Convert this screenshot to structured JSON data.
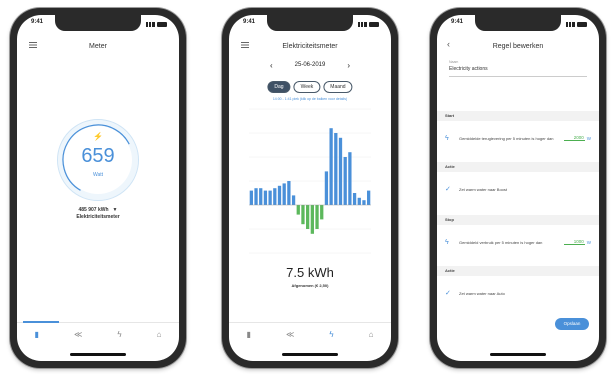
{
  "status": {
    "time": "9:41"
  },
  "phone1": {
    "title": "Meter",
    "gauge": {
      "value": "659",
      "unit": "Watt"
    },
    "meter": {
      "line1": "485 907 kWh",
      "line2": "Elektriciteitsmeter"
    },
    "tabs": [
      "bulb-icon",
      "chart-icon",
      "flash-icon",
      "settings-icon"
    ]
  },
  "phone2": {
    "title": "Elektriciteitsmeter",
    "date": "25-06-2019",
    "segments": [
      "Dag",
      "Week",
      "Maand"
    ],
    "note": "14:00 - 1:41 piek (klik op de balken voor details)",
    "kwh": "7.5  kWh",
    "kwh_sub": "Afgenomen (€ 2,50)",
    "chart_data": {
      "type": "bar",
      "values": [
        6,
        7,
        7,
        6,
        6,
        7,
        8,
        9,
        10,
        4,
        -4,
        -8,
        -10,
        -12,
        -10,
        -6,
        14,
        32,
        30,
        28,
        20,
        22,
        5,
        3,
        2,
        6
      ],
      "ylim": [
        -20,
        40
      ]
    }
  },
  "phone3": {
    "title": "Regel bewerken",
    "name_label": "Naam",
    "name_value": "Electricity actions",
    "sections": {
      "start": "Start",
      "actie1": "Actie",
      "stop": "Stop",
      "actie2": "Actie"
    },
    "start_row": {
      "text": "Gemiddelde teruglevering per 5 minuten is hoger dan",
      "value": "2000",
      "unit": "W"
    },
    "actie1_row": {
      "text": "Zet warm water naar Boost"
    },
    "stop_row": {
      "text": "Gemiddeld verbruik per 5 minuten is hoger dan",
      "value": "1000",
      "unit": "W"
    },
    "actie2_row": {
      "text": "Zet warm water naar Auto"
    },
    "save": "Opslaan"
  }
}
